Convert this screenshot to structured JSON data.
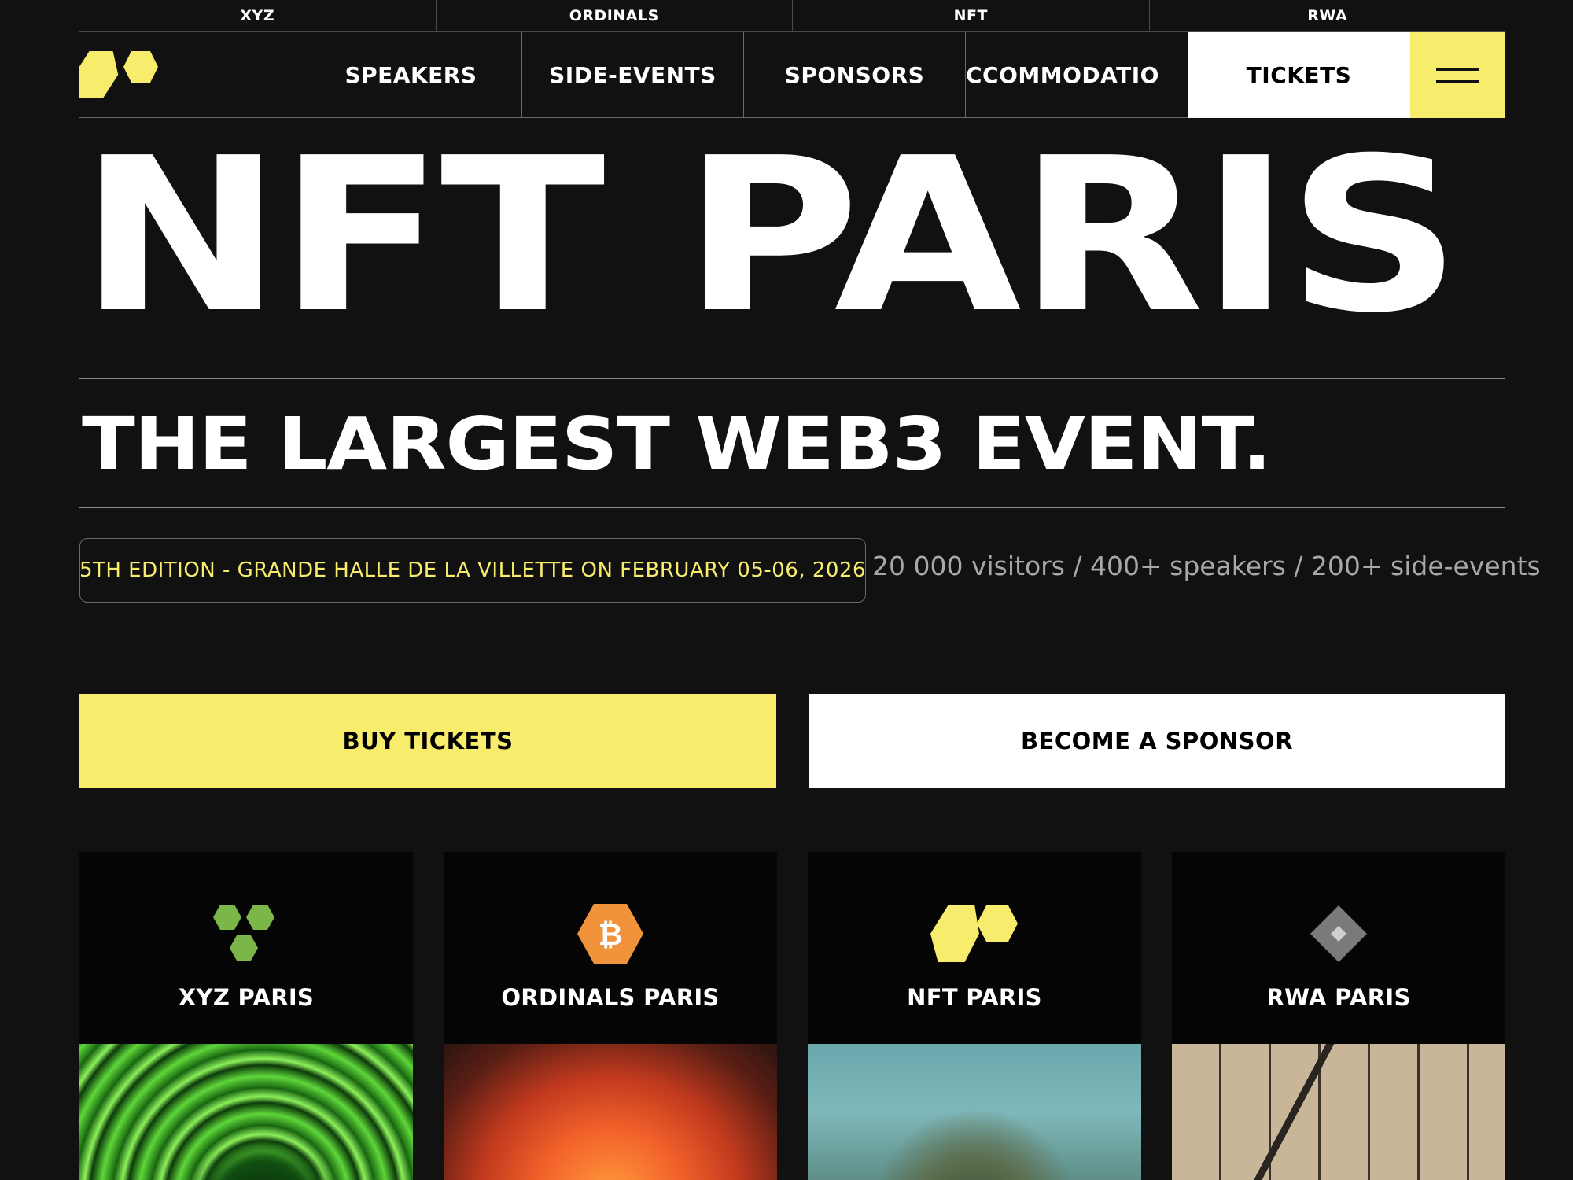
{
  "topbar": {
    "items": [
      "XYZ",
      "ORDINALS",
      "NFT",
      "RWA"
    ]
  },
  "nav": {
    "links": [
      "SPEAKERS",
      "SIDE-EVENTS",
      "SPONSORS",
      "CCOMMODATIO"
    ],
    "tickets_label": "TICKETS"
  },
  "hero": {
    "title": "NFT PARIS",
    "subtitle": "THE LARGEST WEB3 EVENT.",
    "edition": "5TH EDITION - GRANDE HALLE DE LA VILLETTE ON FEBRUARY 05-06, 2026",
    "stats": "20 000 visitors / 400+ speakers / 200+ side-events"
  },
  "cta": {
    "buy_label": "BUY TICKETS",
    "sponsor_label": "BECOME A SPONSOR"
  },
  "cards": [
    {
      "label": "XYZ PARIS",
      "icon": "xyz-hexagons-icon",
      "color": "#7ab648"
    },
    {
      "label": "ORDINALS PARIS",
      "icon": "bitcoin-hexagon-icon",
      "color": "#f0933a"
    },
    {
      "label": "NFT PARIS",
      "icon": "nft-paris-logo-icon",
      "color": "#f7ec6b"
    },
    {
      "label": "RWA PARIS",
      "icon": "rwa-diamond-icon",
      "color": "#7a7a7a"
    }
  ],
  "colors": {
    "background": "#111111",
    "accent_yellow": "#f7ec6b",
    "white": "#ffffff",
    "muted_text": "#a8a8a8"
  }
}
